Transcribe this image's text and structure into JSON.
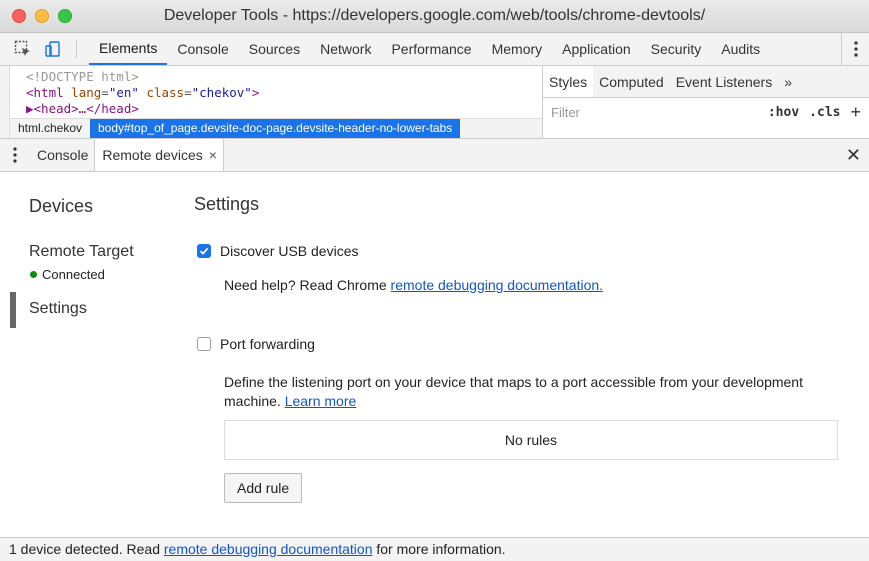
{
  "window": {
    "title": "Developer Tools - https://developers.google.com/web/tools/chrome-devtools/"
  },
  "main_tabs": [
    {
      "label": "Elements",
      "active": true
    },
    {
      "label": "Console"
    },
    {
      "label": "Sources"
    },
    {
      "label": "Network"
    },
    {
      "label": "Performance"
    },
    {
      "label": "Memory"
    },
    {
      "label": "Application"
    },
    {
      "label": "Security"
    },
    {
      "label": "Audits"
    }
  ],
  "elements_panel": {
    "doctype": "<!DOCTYPE html>",
    "html_open": "<",
    "html_tag": "html",
    "lang_attr": "lang",
    "lang_val": "\"en\"",
    "class_attr": "class",
    "class_val": "\"chekov\"",
    "html_close": ">",
    "head_line": "▶<head>…</head>",
    "breadcrumbs": [
      "html.chekov",
      "body#top_of_page.devsite-doc-page.devsite-header-no-lower-tabs"
    ]
  },
  "styles_panel": {
    "tabs": [
      "Styles",
      "Computed",
      "Event Listeners",
      "»"
    ],
    "filter_placeholder": "Filter",
    "hov": ":hov",
    "cls": ".cls",
    "plus": "+"
  },
  "drawer": {
    "tabs": [
      {
        "label": "Console"
      },
      {
        "label": "Remote devices",
        "active": true,
        "close": "×"
      }
    ],
    "close": "✕"
  },
  "remote_devices": {
    "sidebar": {
      "title": "Devices",
      "target": "Remote Target",
      "status": "Connected",
      "settings": "Settings"
    },
    "main": {
      "title": "Settings",
      "discover_usb": {
        "label": "Discover USB devices",
        "checked": true
      },
      "help_prefix": "Need help? Read Chrome ",
      "help_link": "remote debugging documentation.",
      "port_forwarding": {
        "label": "Port forwarding",
        "checked": false
      },
      "desc_text": "Define the listening port on your device that maps to a port accessible from your development machine. ",
      "desc_link": "Learn more",
      "no_rules": "No rules",
      "add_rule": "Add rule"
    }
  },
  "footer": {
    "prefix": "1 device detected. Read ",
    "link": "remote debugging documentation",
    "suffix": " for more information."
  },
  "colors": {
    "accent": "#1a73e8",
    "link": "#1155cc",
    "connected": "#0a8f08"
  }
}
